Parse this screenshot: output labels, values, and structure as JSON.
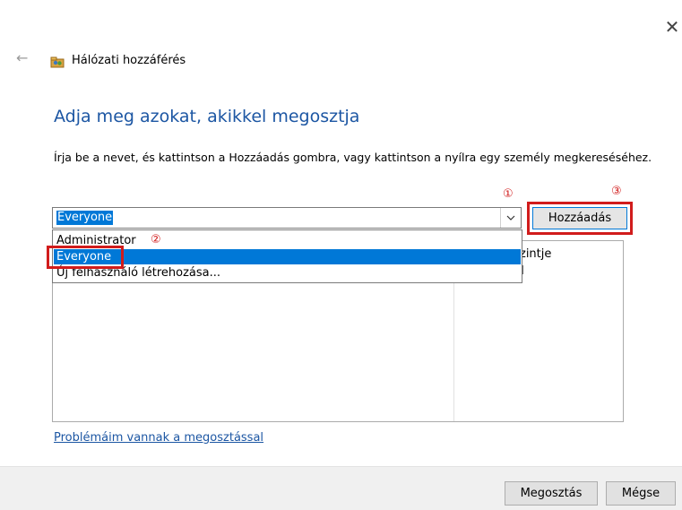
{
  "window": {
    "close_glyph": "✕",
    "back_glyph": "←",
    "title": "Hálózati hozzáférés"
  },
  "main": {
    "heading": "Adja meg azokat, akikkel megosztja",
    "instruction": "Írja be a nevet, és kattintson a Hozzáadás gombra, vagy kattintson a nyílra egy személy megkereséséhez.",
    "combo_value": "Everyone",
    "add_button": "Hozzáadás",
    "list_header_level": "zintje",
    "problems_link": "Problémáim vannak a megosztással"
  },
  "dropdown": {
    "items": [
      {
        "label": "Administrator",
        "selected": false
      },
      {
        "label": "Everyone",
        "selected": true
      },
      {
        "label": "Új felhasználó létrehozása...",
        "selected": false
      }
    ]
  },
  "annotations": {
    "one": "①",
    "two": "②",
    "three": "③"
  },
  "footer": {
    "share_button": "Megosztás",
    "cancel_button": "Mégse"
  },
  "colors": {
    "accent": "#0078d7",
    "heading": "#1c56a3",
    "highlight_frame": "#d11c1c"
  },
  "icons": {
    "window": "network-share-icon",
    "back": "back-arrow-icon",
    "close": "close-icon",
    "dropdown": "chevron-down-icon"
  }
}
